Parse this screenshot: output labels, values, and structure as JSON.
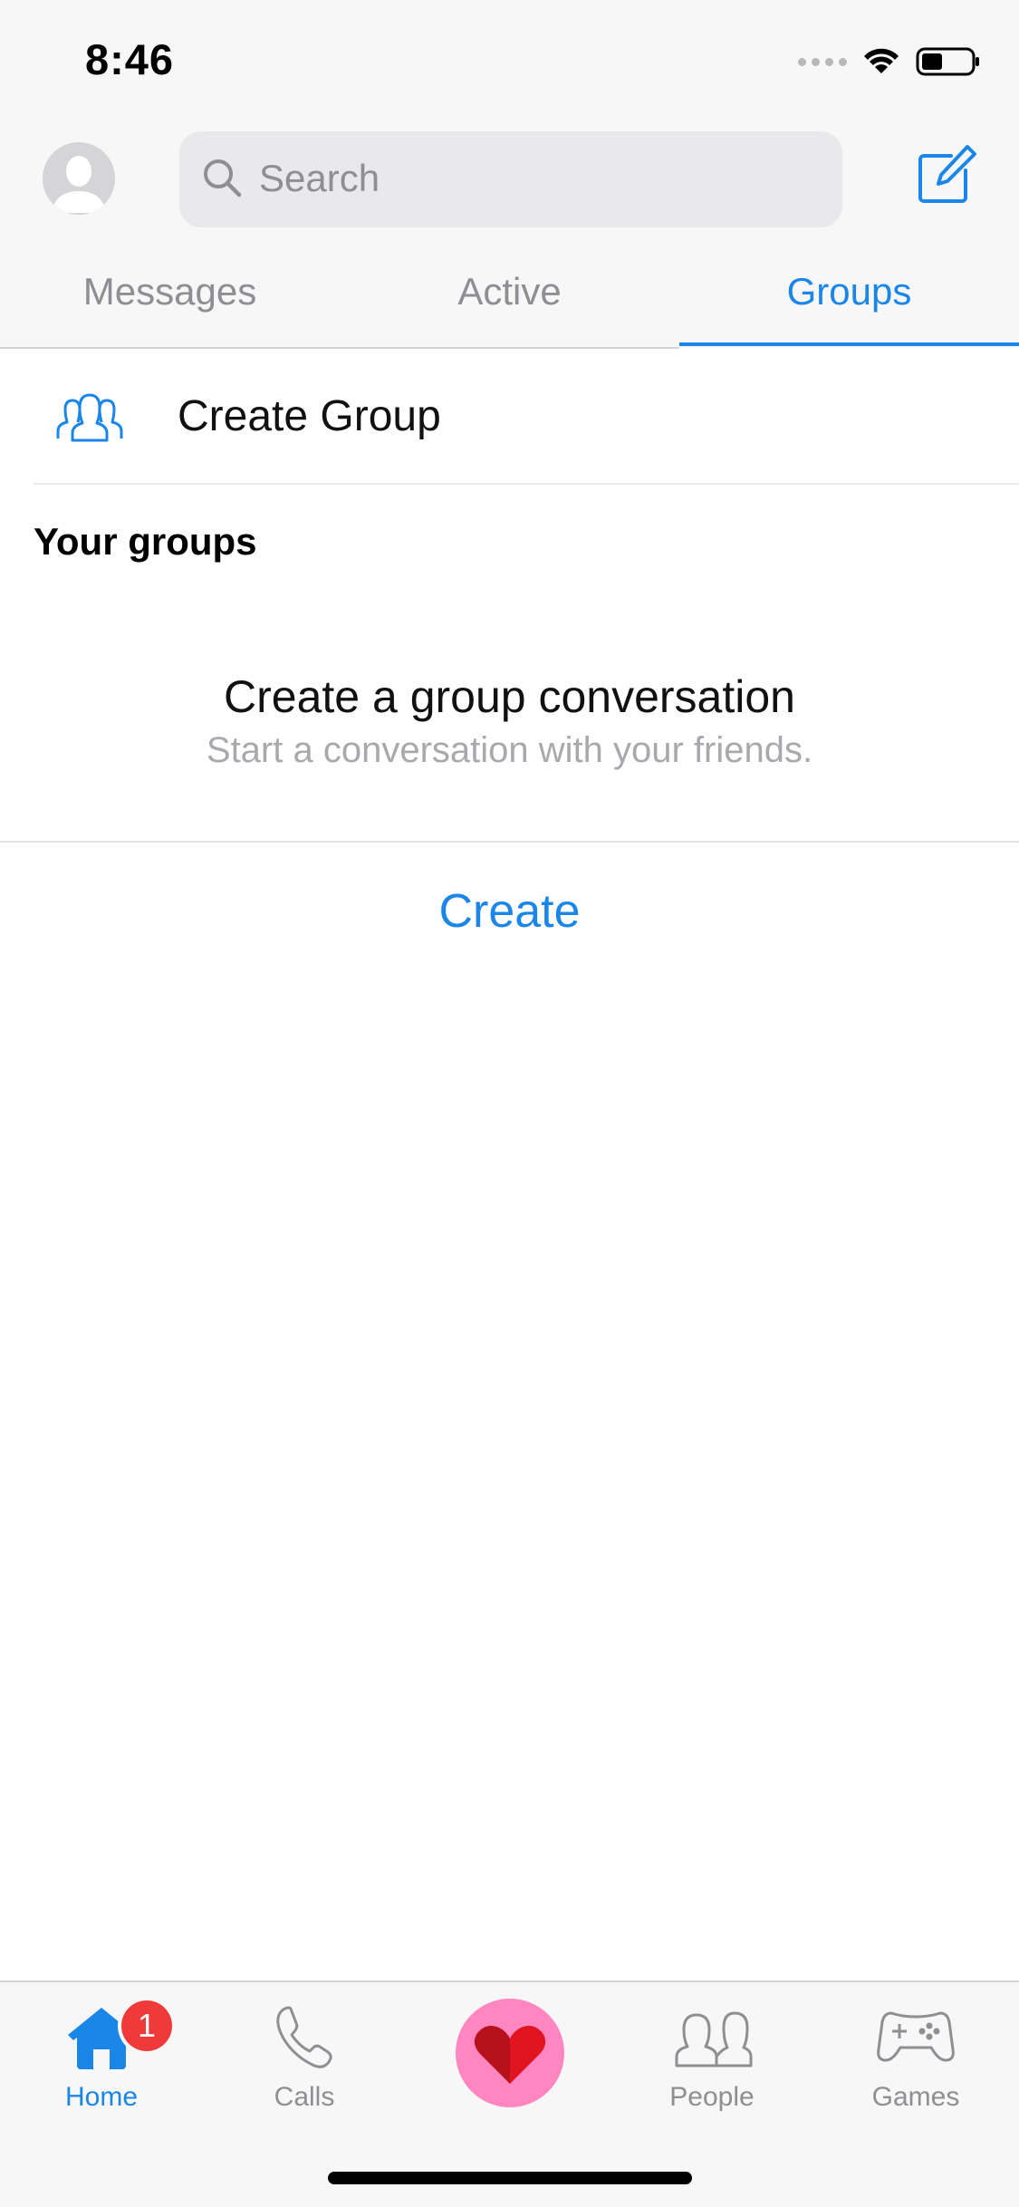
{
  "status_bar": {
    "time": "8:46"
  },
  "header": {
    "search_placeholder": "Search"
  },
  "tabs": [
    {
      "label": "Messages",
      "active": false
    },
    {
      "label": "Active",
      "active": false
    },
    {
      "label": "Groups",
      "active": true
    }
  ],
  "groups": {
    "create_group_label": "Create Group",
    "section_title": "Your groups",
    "empty_title": "Create a group conversation",
    "empty_subtitle": "Start a conversation with your friends.",
    "create_action": "Create"
  },
  "tabbar": {
    "items": [
      {
        "label": "Home",
        "icon": "home-icon",
        "active": true,
        "badge": "1"
      },
      {
        "label": "Calls",
        "icon": "phone-icon",
        "active": false
      },
      {
        "label": "",
        "icon": "heart-icon",
        "active": false
      },
      {
        "label": "People",
        "icon": "people-icon",
        "active": false
      },
      {
        "label": "Games",
        "icon": "gamepad-icon",
        "active": false
      }
    ]
  },
  "colors": {
    "accent": "#1a87e8",
    "badge": "#f03a3a",
    "center_button": "#ff86c0",
    "heart": "#e0151f"
  }
}
